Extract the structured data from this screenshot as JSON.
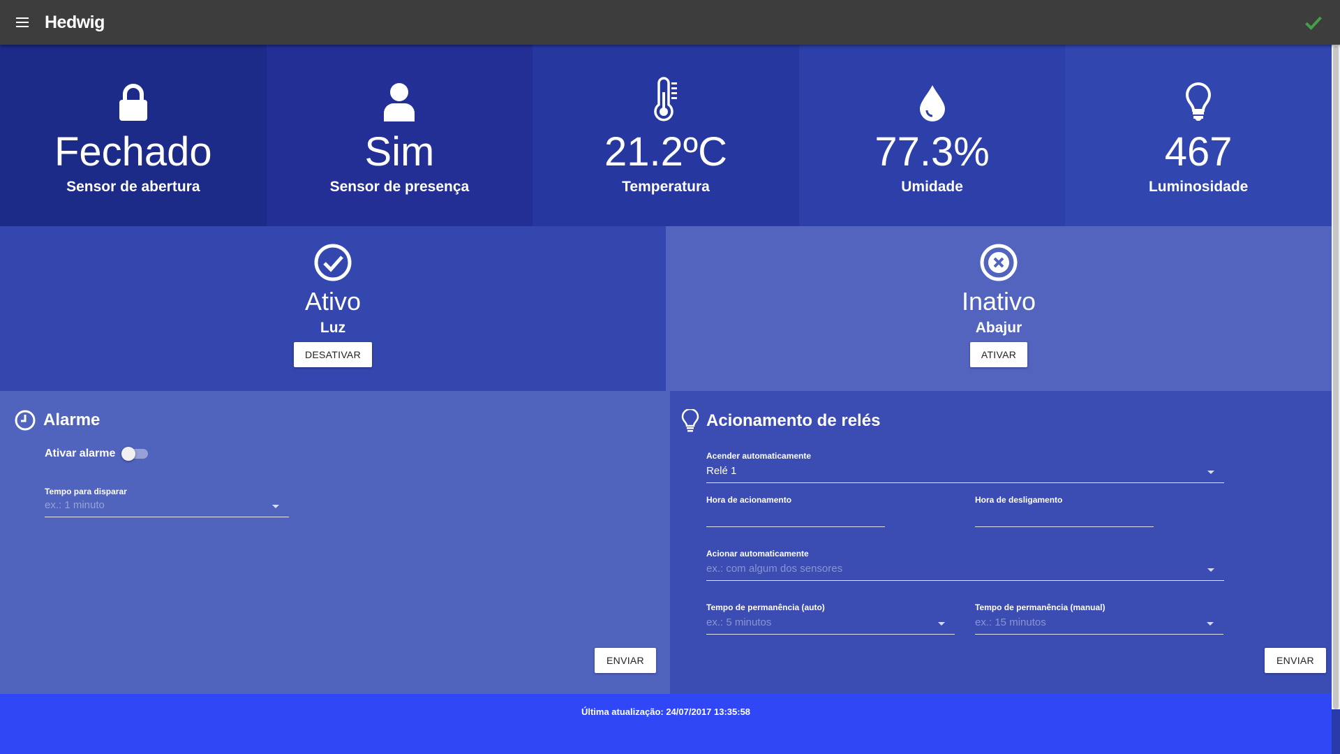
{
  "app": {
    "title": "Hedwig",
    "menu_icon": "menu-icon",
    "status_icon": "check-icon",
    "status_color": "#43a047"
  },
  "sensors": [
    {
      "icon": "lock-icon",
      "value": "Fechado",
      "label": "Sensor de abertura",
      "bg": "#1c2b87"
    },
    {
      "icon": "person-icon",
      "value": "Sim",
      "label": "Sensor de presença",
      "bg": "#232f95"
    },
    {
      "icon": "thermometer-icon",
      "value": "21.2ºC",
      "label": "Temperatura",
      "bg": "#2737a0"
    },
    {
      "icon": "drop-icon",
      "value": "77.3%",
      "label": "Umidade",
      "bg": "#2d3fa8"
    },
    {
      "icon": "bulb-icon",
      "value": "467",
      "label": "Luminosidade",
      "bg": "#3246b0"
    }
  ],
  "relays": [
    {
      "icon": "check-circle-icon",
      "status": "Ativo",
      "name": "Luz",
      "button": "DESATIVAR",
      "bg": "#3447ae"
    },
    {
      "icon": "x-circle-icon",
      "status": "Inativo",
      "name": "Abajur",
      "button": "ATIVAR",
      "bg": "#5264be"
    }
  ],
  "alarm": {
    "title": "Alarme",
    "toggle_label": "Ativar alarme",
    "toggle_on": false,
    "time_label": "Tempo para disparar",
    "time_placeholder": "ex.: 1 minuto",
    "submit": "ENVIAR"
  },
  "relay_config": {
    "title": "Acionamento de relés",
    "auto_on_label": "Acender automaticamente",
    "auto_on_value": "Relé 1",
    "on_time_label": "Hora de acionamento",
    "off_time_label": "Hora de desligamento",
    "auto_trigger_label": "Acionar automaticamente",
    "auto_trigger_placeholder": "ex.: com algum dos sensores",
    "stay_auto_label": "Tempo de permanência (auto)",
    "stay_auto_placeholder": "ex.: 5 minutos",
    "stay_manual_label": "Tempo de permanência (manual)",
    "stay_manual_placeholder": "ex.: 15 minutos",
    "submit": "ENVIAR"
  },
  "footer": {
    "text": "Última atualização: 24/07/2017 13:35:58"
  }
}
